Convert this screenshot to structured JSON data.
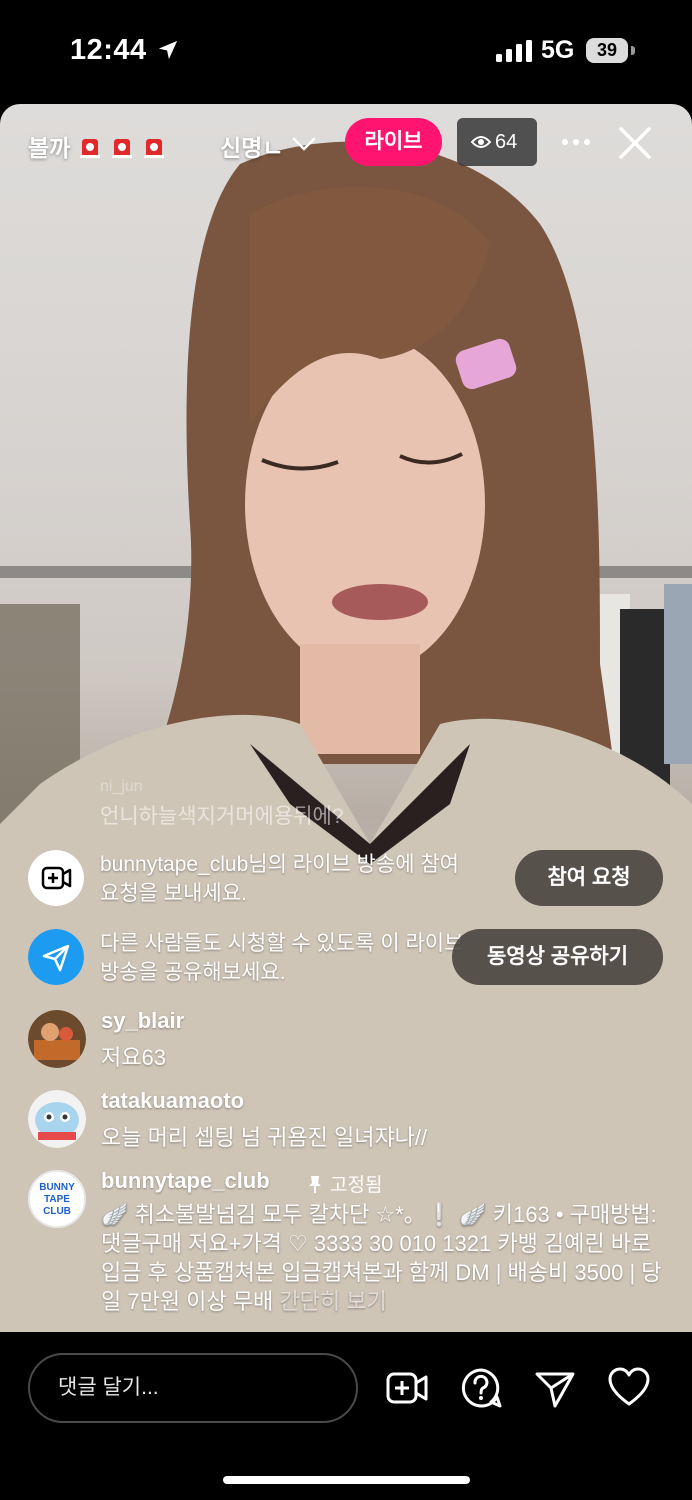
{
  "status_bar": {
    "time": "12:44",
    "network": "5G",
    "battery": "39"
  },
  "header": {
    "title": "볼까",
    "host": "신명ㄴ",
    "live_label": "라이브",
    "viewers": "64"
  },
  "faded_comment": {
    "user": "ni_jun",
    "text": "언니하늘색지거머에용뒤에?"
  },
  "system_rows": [
    {
      "text": "bunnytape_club님의 라이브 방송에 참여 요청을 보내세요.",
      "button": "참여 요청"
    },
    {
      "text": "다른 사람들도 시청할 수 있도록 이 라이브 방송을 공유해보세요.",
      "button": "동영상 공유하기"
    }
  ],
  "comments": [
    {
      "user": "sy_blair",
      "text": "저요63"
    },
    {
      "user": "tatakuamaoto",
      "text": "오늘 머리 셉팅 넘 귀욤진 일녀쟈나//"
    }
  ],
  "pinned": {
    "user": "bunnytape_club",
    "badge": "고정됨",
    "avatar_text": "BUNNY TAPE CLUB",
    "body": "🪽 취소불발넘김 모두 칼차단 ☆*。❕ 🪽 키163 • 구매방법: 댓글구매 저요+가격 ♡ 3333 30 010 1321 카뱅 김예린 바로 입금 후 상품캡쳐본 입금캡쳐본과 함께 DM | 배송비 3500 | 당일 7만원 이상 무배",
    "see_more": "간단히 보기"
  },
  "bottom": {
    "comment_placeholder": "댓글 달기..."
  },
  "colors": {
    "live_pink": "#ff1570",
    "share_blue": "#1d9bf0"
  },
  "icons": [
    "location-arrow-icon",
    "signal-icon",
    "siren-icon",
    "chevron-down-icon",
    "eye-icon",
    "more-icon",
    "close-icon",
    "video-add-icon",
    "send-icon",
    "pin-icon",
    "question-icon",
    "heart-icon"
  ]
}
